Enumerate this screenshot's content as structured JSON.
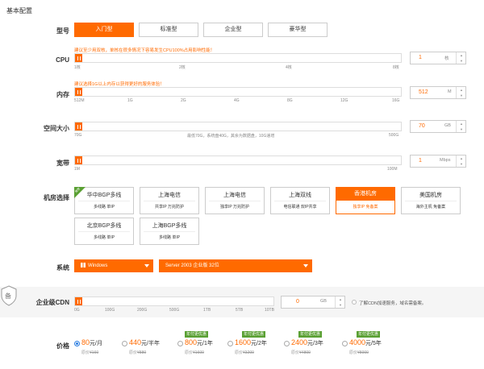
{
  "section_title": "基本配置",
  "labels": {
    "type": "型号",
    "cpu": "CPU",
    "memory": "内存",
    "space": "空间大小",
    "bandwidth": "宽带",
    "room": "机房选择",
    "system": "系统",
    "cdn": "企业级CDN",
    "price": "价格"
  },
  "types": [
    "入门型",
    "标准型",
    "企业型",
    "豪华型"
  ],
  "active_type": 0,
  "cpu": {
    "hint": "建议至少用双核，单核在很多情况下容易发生CPU100%占用影响性能！",
    "ticks": [
      "1核",
      "2核",
      "4核",
      "8核"
    ],
    "value": "1",
    "unit": "核",
    "level": 0
  },
  "memory": {
    "hint": "建议选择1G以上内存以获得更好的服务体验！",
    "ticks": [
      "512M",
      "1G",
      "2G",
      "4G",
      "8G",
      "12G",
      "16G"
    ],
    "value": "512",
    "unit": "M",
    "level": 0
  },
  "space": {
    "ticks": [
      "70G",
      "500G"
    ],
    "note": "最低70G，系统盘40G，其余为数据盘，10G递增",
    "value": "70",
    "unit": "GB",
    "level": 0
  },
  "bandwidth": {
    "ticks": [
      "1M",
      "100M"
    ],
    "value": "1",
    "unit": "Mbps",
    "level": 0
  },
  "rooms": [
    {
      "title": "华中BGP多线",
      "sub": "多线路 单IP",
      "badge": "推荐"
    },
    {
      "title": "上海电信",
      "sub": "共享IP 万兆防护"
    },
    {
      "title": "上海电信",
      "sub": "独享IP 万兆防护"
    },
    {
      "title": "上海双线",
      "sub": "电信联通 双IP共享"
    },
    {
      "title": "香港机房",
      "sub": "独享IP 免备案"
    },
    {
      "title": "美国机房",
      "sub": "海外主机 免备案"
    },
    {
      "title": "北京BGP多线",
      "sub": "多线路 单IP"
    },
    {
      "title": "上海BGP多线",
      "sub": "多线路 单IP"
    }
  ],
  "active_room": 4,
  "os": {
    "name": "Windows",
    "version": "Server 2003 企业版 32位"
  },
  "cdn": {
    "ticks": [
      "0G",
      "100G",
      "200G",
      "500G",
      "1TB",
      "5TB",
      "10TB"
    ],
    "value": "0",
    "unit": "GB",
    "note": "了解CDN加速服务，域名需备案。",
    "seal_text": "备"
  },
  "prices": [
    {
      "num": "80",
      "unit": "元/月",
      "old_label": "原价",
      "old": "¥160",
      "promo": ""
    },
    {
      "num": "440",
      "unit": "元/半年",
      "old_label": "原价",
      "old": "¥880",
      "promo": ""
    },
    {
      "num": "800",
      "unit": "元/1年",
      "old_label": "原价",
      "old": "¥1600",
      "promo": "年付更优惠"
    },
    {
      "num": "1600",
      "unit": "元/2年",
      "old_label": "原价",
      "old": "¥3200",
      "promo": "年付更优惠"
    },
    {
      "num": "2400",
      "unit": "元/3年",
      "old_label": "原价",
      "old": "¥4800",
      "promo": "年付更优惠"
    },
    {
      "num": "4000",
      "unit": "元/5年",
      "old_label": "原价",
      "old": "¥8000",
      "promo": "年付更优惠"
    }
  ],
  "selected_price": 0,
  "colors": {
    "accent": "#ff6a00",
    "promo": "#5aa033",
    "radio": "#2a7de1"
  }
}
